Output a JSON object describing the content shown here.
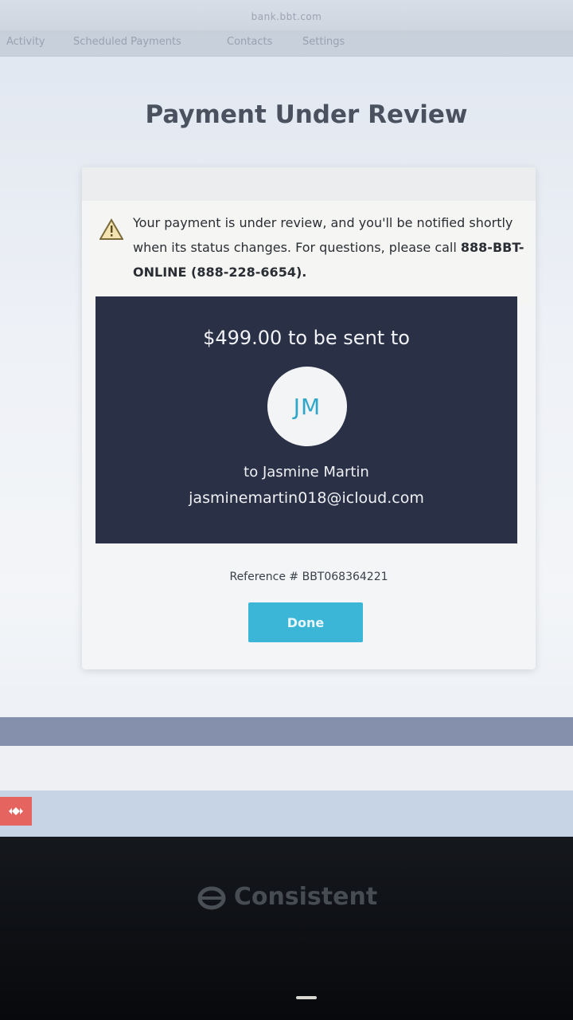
{
  "browser": {
    "url": "bank.bbt.com"
  },
  "nav": {
    "items": [
      "Activity",
      "Scheduled Payments",
      "Contacts",
      "Settings"
    ]
  },
  "page": {
    "title": "Payment Under Review"
  },
  "alert": {
    "text": "Your payment is under review, and you'll be notified shortly when its status changes. For questions, please call",
    "phone": "888-BBT-ONLINE (888-228-6654)."
  },
  "payment": {
    "amount_line": "$499.00 to be sent to",
    "initials": "JM",
    "recipient_line": "to Jasmine Martin",
    "email": "jasminemartin018@icloud.com",
    "reference": "Reference # BBT068364221"
  },
  "actions": {
    "done_label": "Done"
  },
  "monitor": {
    "brand": "Consistent"
  },
  "colors": {
    "accent": "#3cb6d6",
    "panel": "#2a3045",
    "warning": "#e0b23a"
  }
}
